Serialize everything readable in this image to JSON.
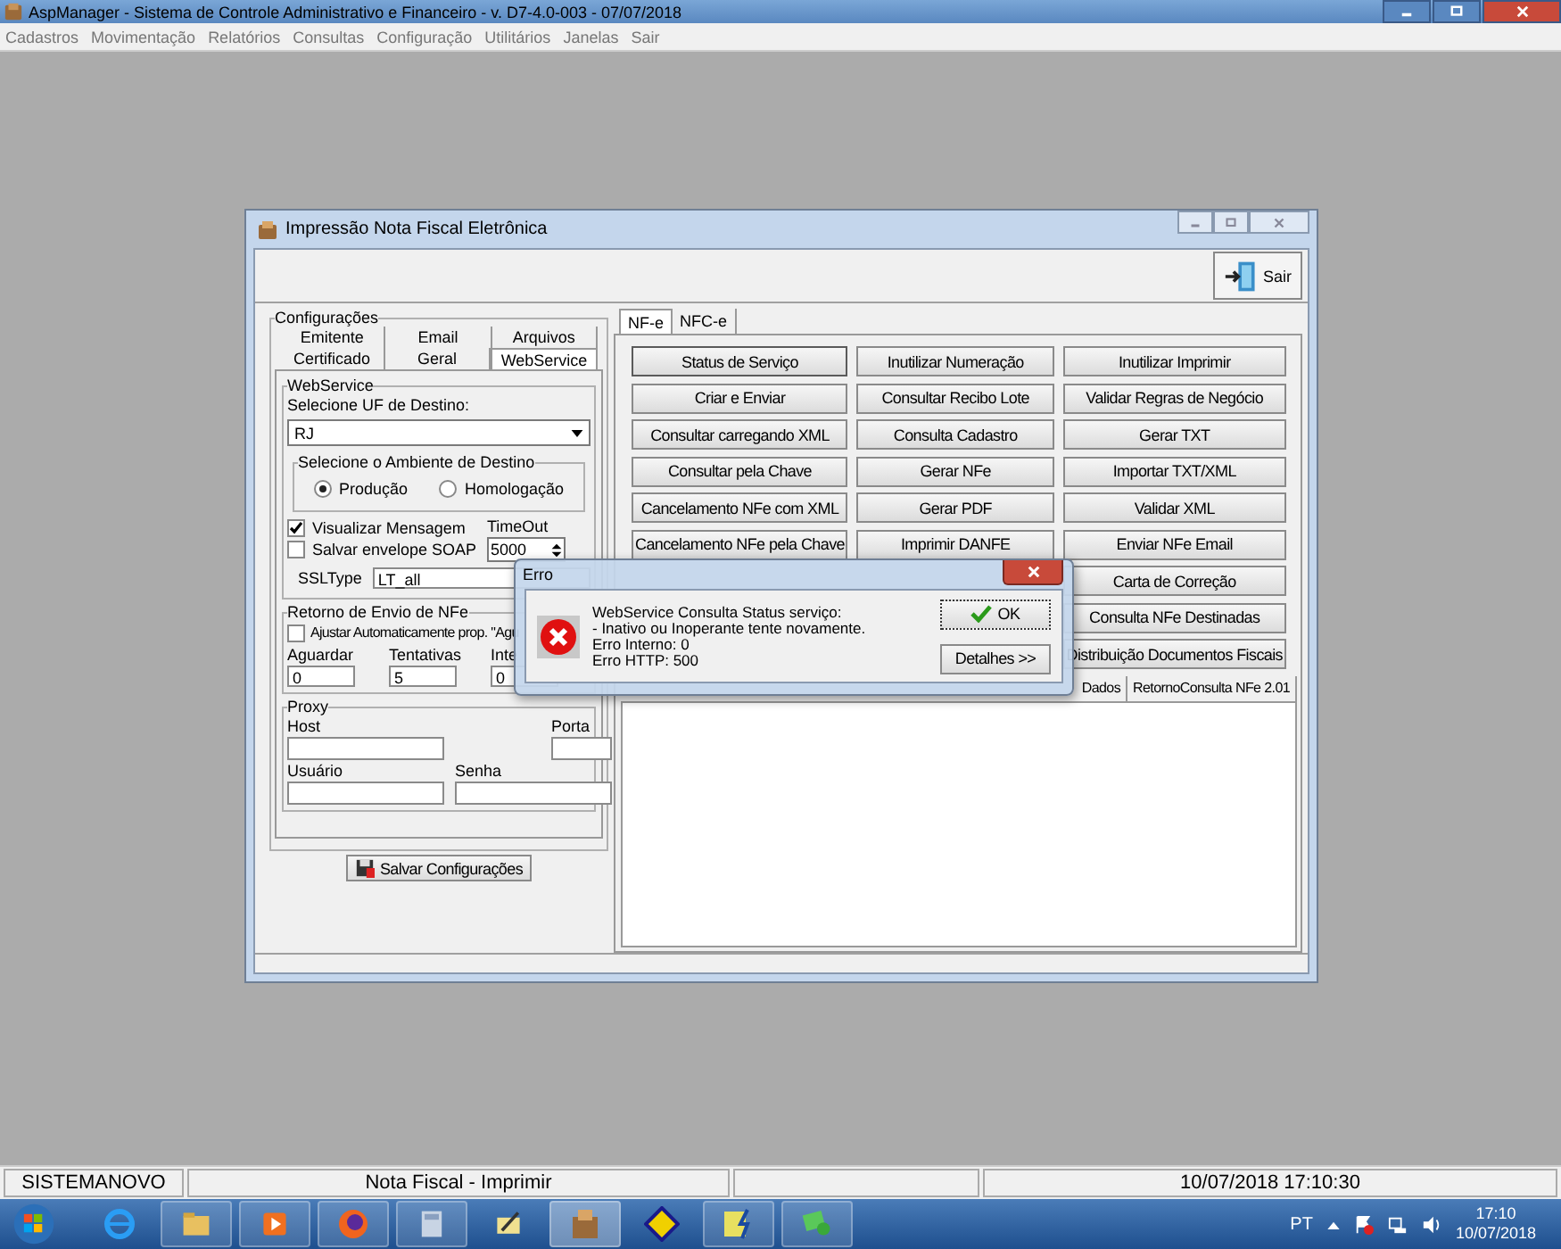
{
  "app_window": {
    "title": "AspManager - Sistema de Controle Administrativo e Financeiro - v. D7-4.0-003 - 07/07/2018",
    "menu": [
      "Cadastros",
      "Movimentação",
      "Relatórios",
      "Consultas",
      "Configuração",
      "Utilitários",
      "Janelas",
      "Sair"
    ]
  },
  "nfe_window": {
    "title": "Impressão Nota Fiscal Eletrônica",
    "exit_button": "Sair",
    "config": {
      "title": "Configurações",
      "tab_rows": [
        [
          {
            "label": "Emitente",
            "selected": false
          },
          {
            "label": "Email",
            "selected": false
          },
          {
            "label": "Arquivos",
            "selected": false
          }
        ],
        [
          {
            "label": "Certificado",
            "selected": false
          },
          {
            "label": "Geral",
            "selected": false
          },
          {
            "label": "WebService",
            "selected": true
          }
        ]
      ],
      "webservice": {
        "title": "WebService",
        "uf_label": "Selecione UF de Destino:",
        "uf_value": "RJ",
        "environment": {
          "title": "Selecione o Ambiente de Destino",
          "options": [
            {
              "label": "Produção",
              "selected": true
            },
            {
              "label": "Homologação",
              "selected": false
            }
          ]
        },
        "checks": [
          {
            "label": "Visualizar Mensagem",
            "checked": true
          },
          {
            "label": "Salvar envelope SOAP",
            "checked": false
          }
        ],
        "timeout_label": "TimeOut",
        "timeout_value": "5000",
        "ssl_label": "SSLType",
        "ssl_value": "LT_all"
      },
      "return": {
        "title": "Retorno de Envio de NFe",
        "check": {
          "label": "Ajustar Automaticamente prop. \"Agu",
          "checked": false
        },
        "fields": [
          {
            "label": "Aguardar",
            "value": "0"
          },
          {
            "label": "Tentativas",
            "value": "5"
          },
          {
            "label": "Inte",
            "value": "0"
          }
        ]
      },
      "proxy": {
        "title": "Proxy",
        "fields": [
          {
            "label": "Host"
          },
          {
            "label": "Porta"
          },
          {
            "label": "Usuário"
          },
          {
            "label": "Senha"
          }
        ]
      },
      "save_button": "Salvar Configurações"
    },
    "tabs": [
      {
        "label": "NF-e",
        "selected": true
      },
      {
        "label": "NFC-e",
        "selected": false
      }
    ],
    "buttons": [
      {
        "label": "Status de Serviço"
      },
      {
        "label": "Inutilizar Numeração"
      },
      {
        "label": "Inutilizar Imprimir"
      },
      {
        "label": "Criar e Enviar"
      },
      {
        "label": "Consultar Recibo Lote"
      },
      {
        "label": "Validar Regras de Negócio"
      },
      {
        "label": "Consultar carregando XML"
      },
      {
        "label": "Consulta Cadastro"
      },
      {
        "label": "Gerar TXT"
      },
      {
        "label": "Consultar pela Chave"
      },
      {
        "label": "Gerar NFe"
      },
      {
        "label": "Importar TXT/XML"
      },
      {
        "label": "Cancelamento NFe com XML"
      },
      {
        "label": "Gerar PDF"
      },
      {
        "label": "Validar XML"
      },
      {
        "label": "Cancelamento NFe pela Chave"
      },
      {
        "label": "Imprimir DANFE"
      },
      {
        "label": "Enviar NFe Email"
      },
      {
        "label": "Carta de Correção"
      },
      {
        "label": "Consulta NFe Destinadas"
      },
      {
        "label": "Distribuição Documentos Fiscais"
      }
    ],
    "result_tabs": [
      {
        "label": "Dados",
        "selected": false
      },
      {
        "label": "RetornoConsulta NFe 2.01",
        "selected": false
      }
    ]
  },
  "error_dialog": {
    "title": "Erro",
    "message": [
      "WebService Consulta Status serviço:",
      "- Inativo ou Inoperante tente novamente.",
      "Erro Interno: 0",
      "Erro HTTP: 500"
    ],
    "ok_button": "OK",
    "details_button": "Detalhes >>"
  },
  "status_bar": {
    "company": "SISTEMANOVO",
    "screen": "Nota Fiscal - Imprimir",
    "datetime": "10/07/2018 17:10:30"
  },
  "taskbar": {
    "language": "PT",
    "time": "17:10",
    "date": "10/07/2018"
  }
}
